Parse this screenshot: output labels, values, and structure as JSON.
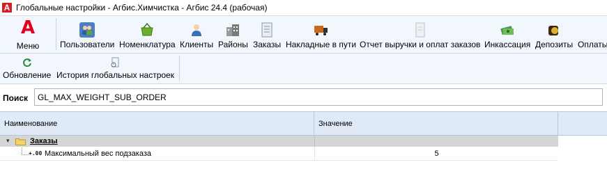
{
  "window": {
    "title": "Глобальные настройки - Агбис.Химчистка - Агбис 24.4 (рабочая)"
  },
  "ribbon": {
    "menu_logo": "A",
    "menu_label": "Меню",
    "items": [
      {
        "label": "Пользователи",
        "icon": "users-icon",
        "color": "#4a7fc1",
        "glyph": "👥"
      },
      {
        "label": "Номенклатура",
        "icon": "basket-icon",
        "color": "#5aa02c",
        "glyph": "🧺"
      },
      {
        "label": "Клиенты",
        "icon": "client-icon",
        "color": "#3b6fb6",
        "glyph": "👤"
      },
      {
        "label": "Районы",
        "icon": "buildings-icon",
        "color": "#8a8a8a",
        "glyph": "🏢"
      },
      {
        "label": "Заказы",
        "icon": "document-icon",
        "color": "#9aa8b8",
        "glyph": "📄"
      },
      {
        "label": "Накладные в пути",
        "icon": "truck-icon",
        "color": "#c86a1a",
        "glyph": "🚚"
      },
      {
        "label": "Отчет выручки и оплат заказов",
        "icon": "report-icon",
        "color": "#b8c0c8",
        "glyph": "📋"
      },
      {
        "label": "Инкассация",
        "icon": "money-icon",
        "color": "#3f8f3f",
        "glyph": "💵"
      },
      {
        "label": "Депозиты",
        "icon": "coin-icon",
        "color": "#6b4a1a",
        "glyph": "💰"
      },
      {
        "label": "Оплаты",
        "icon": "payments-icon",
        "color": "#c0c0c0",
        "glyph": ""
      }
    ]
  },
  "toolbar": {
    "items": [
      {
        "label": "Обновление",
        "icon": "refresh-icon"
      },
      {
        "label": "История глобальных настроек",
        "icon": "history-icon"
      }
    ]
  },
  "search": {
    "label": "Поиск",
    "value": "GL_MAX_WEIGHT_SUB_ORDER"
  },
  "grid": {
    "columns": [
      "Наименование",
      "Значение"
    ],
    "group": {
      "label": "Заказы",
      "expanded": true
    },
    "rows": [
      {
        "name": "Максимальный вес подзаказа",
        "value": "5"
      }
    ]
  }
}
